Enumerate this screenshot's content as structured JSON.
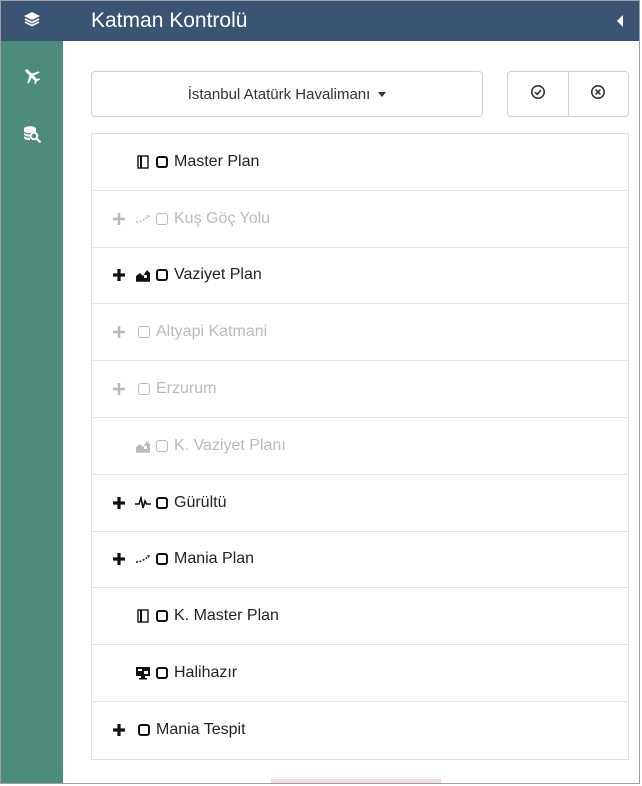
{
  "panel": {
    "title": "Katman Kontrolü",
    "colors": {
      "header": "#3b5474",
      "sidebar": "#4d8b7d",
      "disabled_text": "#b7bcc1"
    }
  },
  "sidebar": {
    "items": [
      {
        "icon": "layers-icon"
      },
      {
        "icon": "plane-icon"
      },
      {
        "icon": "database-search-icon"
      }
    ]
  },
  "selector": {
    "value": "İstanbul Atatürk Havalimanı"
  },
  "actions": {
    "select_all_icon": "check-circle-icon",
    "clear_all_icon": "x-circle-icon"
  },
  "layers": [
    {
      "label": "Master Plan",
      "expand": false,
      "type_icon": "document-icon",
      "disabled": false
    },
    {
      "label": "Kuş Göç Yolu",
      "expand": true,
      "type_icon": "flight-path-icon",
      "disabled": true
    },
    {
      "label": "Vaziyet Plan",
      "expand": true,
      "type_icon": "area-chart-icon",
      "disabled": false
    },
    {
      "label": "Altyapi Katmani",
      "expand": true,
      "type_icon": "",
      "disabled": true
    },
    {
      "label": "Erzurum",
      "expand": true,
      "type_icon": "",
      "disabled": true
    },
    {
      "label": "K. Vaziyet Planı",
      "expand": false,
      "type_icon": "area-chart-icon",
      "disabled": true
    },
    {
      "label": "Gürültü",
      "expand": true,
      "type_icon": "pulse-icon",
      "disabled": false
    },
    {
      "label": "Mania Plan",
      "expand": true,
      "type_icon": "flight-path-icon",
      "disabled": false
    },
    {
      "label": "K. Master Plan",
      "expand": false,
      "type_icon": "document-icon",
      "disabled": false
    },
    {
      "label": "Halihazır",
      "expand": false,
      "type_icon": "monitor-icon",
      "disabled": false
    },
    {
      "label": "Mania Tespit",
      "expand": true,
      "type_icon": "",
      "disabled": false
    }
  ]
}
